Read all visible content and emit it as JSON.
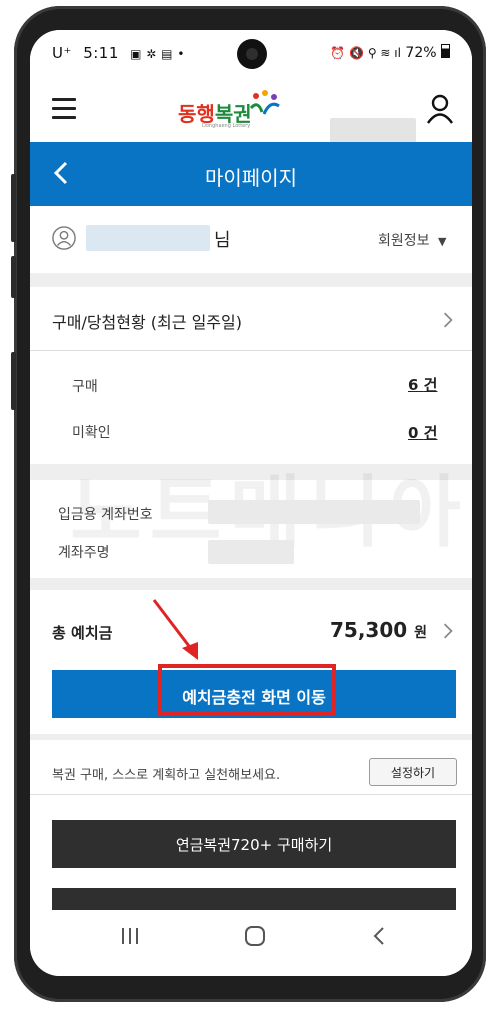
{
  "status_bar": {
    "carrier": "U⁺",
    "time": "5:11",
    "battery": "72%"
  },
  "app": {
    "logo_text_1": "동행",
    "logo_text_2": "복권",
    "logo_sub": "Donghaeng Lottery"
  },
  "title_bar": {
    "title": "마이페이지"
  },
  "member": {
    "suffix": "님",
    "info_label": "회원정보"
  },
  "purchase_status": {
    "header": "구매/당첨현황 (최근 일주일)",
    "purchase_label": "구매",
    "purchase_value": "6",
    "purchase_unit": "건",
    "unchecked_label": "미확인",
    "unchecked_value": "0",
    "unchecked_unit": "건"
  },
  "account": {
    "number_label": "입금용 계좌번호",
    "holder_label": "계좌주명"
  },
  "deposit": {
    "label": "총 예치금",
    "amount": "75,300",
    "unit": "원",
    "charge_button": "예치금충전 화면 이동"
  },
  "plan": {
    "text": "복권 구매, 스스로 계획하고 실천해보세요.",
    "setting_button": "설정하기"
  },
  "buy": {
    "pension_button": "연금복권720+ 구매하기"
  },
  "colors": {
    "primary": "#0a74c4",
    "highlight": "#e02424",
    "dark_button": "#2f2f2f"
  }
}
